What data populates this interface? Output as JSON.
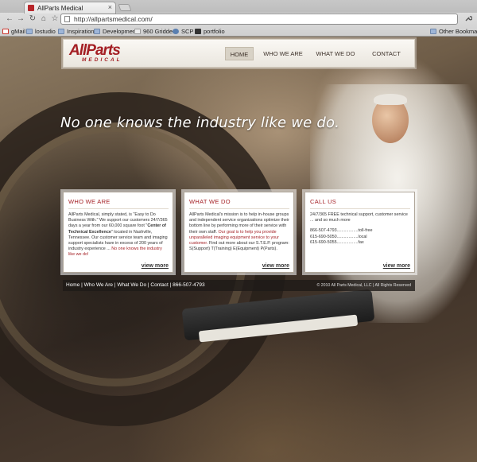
{
  "browser": {
    "tab_title": "AllParts Medical",
    "tab_close": "×",
    "url": "http://allpartsmedical.com/",
    "back": "←",
    "forward": "→",
    "reload": "↻",
    "home": "⌂",
    "star": "☆",
    "bookmarks": [
      {
        "label": "gMail",
        "icon": "gmail-icon",
        "color": "#c9342b"
      },
      {
        "label": "lostudio",
        "icon": "folder-icon",
        "color": "#9fb6d8"
      },
      {
        "label": "Inspiration",
        "icon": "folder-icon",
        "color": "#9fb6d8"
      },
      {
        "label": "Development",
        "icon": "folder-icon",
        "color": "#9fb6d8"
      },
      {
        "label": "960 Gridder",
        "icon": "page-icon",
        "color": "#cccccc"
      },
      {
        "label": "SCP",
        "icon": "gear-icon",
        "color": "#5a7fb0"
      },
      {
        "label": "portfolio",
        "icon": "page-icon",
        "color": "#333333"
      }
    ],
    "other_bookmarks": "Other Bookmarks"
  },
  "site": {
    "logo_main": "AllParts",
    "logo_sub": "MEDICAL",
    "nav": [
      {
        "label": "HOME",
        "active": true
      },
      {
        "label": "WHO WE ARE",
        "active": false
      },
      {
        "label": "WHAT WE DO",
        "active": false
      },
      {
        "label": "CONTACT",
        "active": false
      }
    ],
    "tagline": "No one knows the industry like we do.",
    "boxes": {
      "who": {
        "title": "WHO WE ARE",
        "p1": "AllParts Medical, simply stated, is \"Easy to Do Business With.\" We support our customers 24/7/365 days a year from our 60,000 square foot \"",
        "p1_bold": "Center of Technical Excellence",
        "p2": "\" located in Nashville, Tennessee. Our customer service team and imaging support specialists have in excess of 200 years of industry experience ... ",
        "p2_red": "No one knows the industry like we do!",
        "view_more": "view more"
      },
      "what": {
        "title": "WHAT WE DO",
        "p1": "AllParts Medical's mission is to help in-house groups and independent service organizations optimize their bottom line by performing more of their service with their own staff. ",
        "p1_red": "Our goal is to help you provide unparalleled imaging equipment service to your customer.",
        "p2": " Find out more about our S.T.E.P. program: S(Support) T(Training) E(Equipment) P(Parts).",
        "view_more": "view more"
      },
      "call": {
        "title": "CALL US",
        "intro": "24/7/365 FREE technical support, customer service ... and so much more",
        "lines": [
          "866-507-4793..................toll-free",
          "615-690-5050..................local",
          "615-690-5055..................fax"
        ],
        "view_more": "view more"
      }
    },
    "footer": {
      "links": [
        "Home",
        "Who We Are",
        "What We Do",
        "Contact"
      ],
      "separator": " | ",
      "phone": "866-507-4793",
      "copyright": "© 2010 All Parts Medical, LLC | All Rights Reserved"
    },
    "colors": {
      "brand_red": "#a41f24",
      "header_bg": "#f3f0ea",
      "footer_bg": "#1e1a17"
    }
  }
}
